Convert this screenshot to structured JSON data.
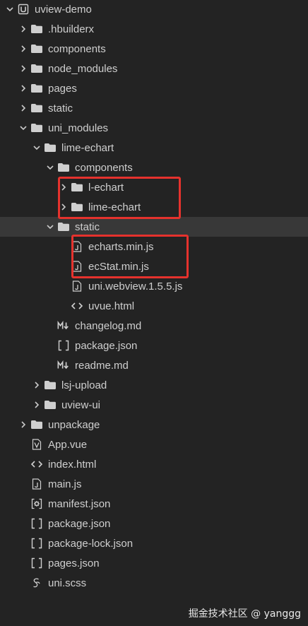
{
  "tree": [
    {
      "label": "uviewdemo",
      "display": "uview-demo",
      "depth": 0,
      "type": "project",
      "expanded": true
    },
    {
      "label": ".hbuilderx",
      "depth": 1,
      "type": "folder",
      "expanded": false
    },
    {
      "label": "components",
      "depth": 1,
      "type": "folder",
      "expanded": false
    },
    {
      "label": "node_modules",
      "depth": 1,
      "type": "folder",
      "expanded": false
    },
    {
      "label": "pages",
      "depth": 1,
      "type": "folder",
      "expanded": false
    },
    {
      "label": "static",
      "depth": 1,
      "type": "folder",
      "expanded": false
    },
    {
      "label": "uni_modules",
      "depth": 1,
      "type": "folder",
      "expanded": true
    },
    {
      "label": "lime-echart",
      "depth": 2,
      "type": "folder",
      "expanded": true
    },
    {
      "label": "components",
      "depth": 3,
      "type": "folder",
      "expanded": true
    },
    {
      "label": "l-echart",
      "depth": 4,
      "type": "folder",
      "expanded": false
    },
    {
      "label": "lime-echart",
      "depth": 4,
      "type": "folder",
      "expanded": false
    },
    {
      "label": "static",
      "depth": 3,
      "type": "folder",
      "expanded": true,
      "selected": true
    },
    {
      "label": "echarts.min.js",
      "depth": 4,
      "type": "js"
    },
    {
      "label": "ecStat.min.js",
      "depth": 4,
      "type": "js"
    },
    {
      "label": "uni.webview.1.5.5.js",
      "depth": 4,
      "type": "js"
    },
    {
      "label": "uvue.html",
      "depth": 4,
      "type": "html"
    },
    {
      "label": "changelog.md",
      "depth": 3,
      "type": "md"
    },
    {
      "label": "package.json",
      "depth": 3,
      "type": "json"
    },
    {
      "label": "readme.md",
      "depth": 3,
      "type": "md"
    },
    {
      "label": "lsj-upload",
      "depth": 2,
      "type": "folder",
      "expanded": false
    },
    {
      "label": "uview-ui",
      "depth": 2,
      "type": "folder",
      "expanded": false
    },
    {
      "label": "unpackage",
      "depth": 1,
      "type": "folder",
      "expanded": false
    },
    {
      "label": "App.vue",
      "depth": 1,
      "type": "vue"
    },
    {
      "label": "index.html",
      "depth": 1,
      "type": "html"
    },
    {
      "label": "main.js",
      "depth": 1,
      "type": "js"
    },
    {
      "label": "manifest.json",
      "depth": 1,
      "type": "manifest"
    },
    {
      "label": "package.json",
      "depth": 1,
      "type": "json"
    },
    {
      "label": "package-lock.json",
      "depth": 1,
      "type": "json"
    },
    {
      "label": "pages.json",
      "depth": 1,
      "type": "json"
    },
    {
      "label": "uni.scss",
      "depth": 1,
      "type": "scss"
    }
  ],
  "watermark": "掘金技术社区 @ yanggg",
  "colors": {
    "background": "#232323",
    "selected": "#383838",
    "highlight": "#e5322d",
    "text": "#cfcfcf"
  }
}
